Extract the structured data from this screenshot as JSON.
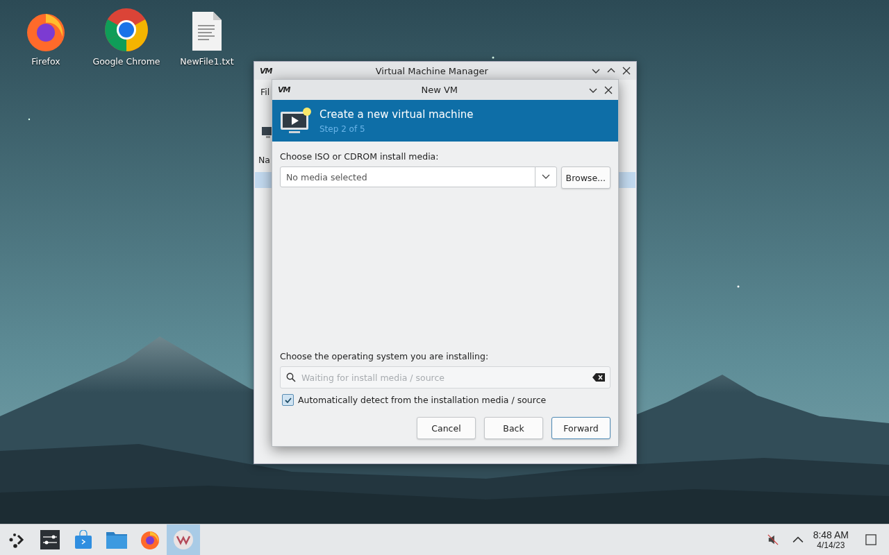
{
  "desktop_icons": [
    {
      "label": "Firefox",
      "kind": "firefox"
    },
    {
      "label": "Google Chrome",
      "kind": "chrome"
    },
    {
      "label": "NewFile1.txt",
      "kind": "file"
    }
  ],
  "main_window": {
    "logo": "VM",
    "title": "Virtual Machine Manager",
    "menu_partial": "Fil",
    "column_partial": "Na"
  },
  "dialog": {
    "logo": "VM",
    "title": "New VM",
    "banner_title": "Create a new virtual machine",
    "banner_subtitle": "Step 2 of 5",
    "media_label": "Choose ISO or CDROM install media:",
    "media_placeholder": "No media selected",
    "browse": "Browse...",
    "os_label": "Choose the operating system you are installing:",
    "os_placeholder": "Waiting for install media / source",
    "auto_detect": {
      "label": "Automatically detect from the installation media / source",
      "checked": true
    },
    "buttons": [
      {
        "label": "Cancel",
        "default": false
      },
      {
        "label": "Back",
        "default": false
      },
      {
        "label": "Forward",
        "default": true
      }
    ]
  },
  "taskbar": {
    "items": [
      {
        "kind": "launcher",
        "selected": false
      },
      {
        "kind": "settings",
        "selected": false
      },
      {
        "kind": "store",
        "selected": false
      },
      {
        "kind": "files",
        "selected": false
      },
      {
        "kind": "firefox",
        "selected": false
      },
      {
        "kind": "vm",
        "selected": true
      }
    ],
    "time": "8:48 AM",
    "date": "4/14/23"
  }
}
